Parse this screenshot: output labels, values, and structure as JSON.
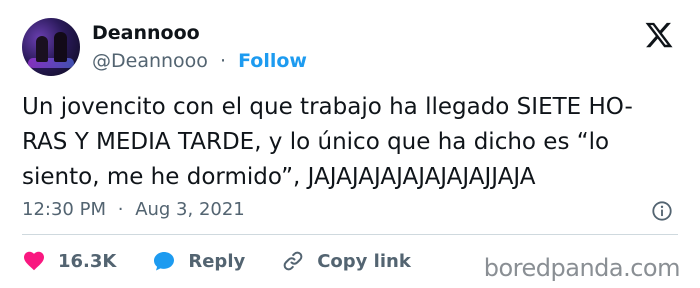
{
  "tweet": {
    "author_name": "Deannooo",
    "handle": "@Deannooo",
    "separator": "·",
    "follow_label": "Follow",
    "text_lines": [
      "Un jovencito con el que trabajo ha llegado SIETE HO-",
      "RAS Y MEDIA TARDE, y lo único que ha dicho es “lo",
      "siento, me he dormido”, JAJAJAJAJAJAJAJAJJAJA"
    ],
    "time": "12:30 PM",
    "date": "Aug 3, 2021"
  },
  "actions": {
    "likes_count": "16.3K",
    "reply_label": "Reply",
    "copy_link_label": "Copy link"
  },
  "colors": {
    "like": "#f91880",
    "reply": "#1d9bf0",
    "follow": "#1d9bf0",
    "muted": "#536471"
  },
  "icons": {
    "brand": "x-logo-icon",
    "info": "info-icon",
    "like": "heart-icon",
    "reply": "speech-bubble-icon",
    "copy": "link-icon"
  },
  "watermark": "boredpanda.com"
}
